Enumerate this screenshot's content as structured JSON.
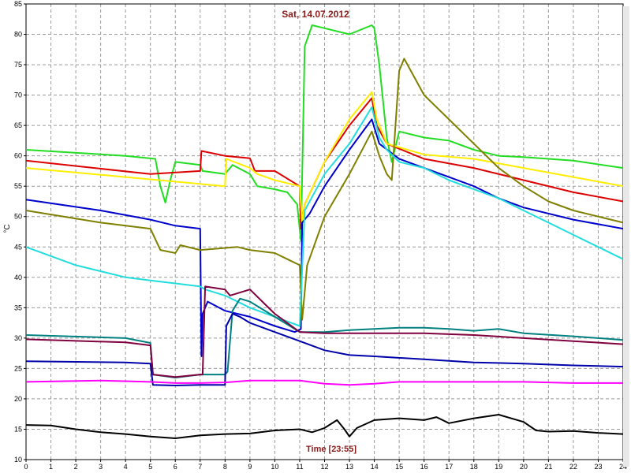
{
  "chart_data": {
    "type": "line",
    "title": "Sat, 14.07.2012",
    "xlabel": "Time [23:55]",
    "ylabel": "°C",
    "xlim": [
      0,
      24
    ],
    "ylim": [
      10,
      85
    ],
    "x_ticks": [
      "0",
      "1",
      "2",
      "3",
      "4",
      "5",
      "6",
      "7",
      "8",
      "9",
      "10",
      "11",
      "12",
      "13",
      "14",
      "15",
      "16",
      "17",
      "18",
      "19",
      "20",
      "21",
      "22",
      "23",
      "24"
    ],
    "y_ticks": [
      "10",
      "15",
      "20",
      "25",
      "30",
      "35",
      "40",
      "45",
      "50",
      "55",
      "60",
      "65",
      "70",
      "75",
      "80",
      "85"
    ],
    "grid": true,
    "series": [
      {
        "color": "#22dd22",
        "points": [
          [
            0,
            61
          ],
          [
            4,
            60
          ],
          [
            5.2,
            59.5
          ],
          [
            5.4,
            55
          ],
          [
            5.6,
            52.3
          ],
          [
            5.8,
            56
          ],
          [
            6,
            59
          ],
          [
            7,
            58.5
          ],
          [
            7.1,
            57.5
          ],
          [
            8,
            57
          ],
          [
            8.3,
            58.5
          ],
          [
            9,
            57
          ],
          [
            9.3,
            55
          ],
          [
            10,
            54.5
          ],
          [
            10.5,
            54
          ],
          [
            10.9,
            52
          ],
          [
            11.05,
            46
          ],
          [
            11.2,
            78
          ],
          [
            11.5,
            81.5
          ],
          [
            12,
            81
          ],
          [
            13,
            80
          ],
          [
            13.9,
            81.5
          ],
          [
            14,
            81
          ],
          [
            14.2,
            75
          ],
          [
            14.5,
            63
          ],
          [
            14.7,
            59
          ],
          [
            15,
            64
          ],
          [
            16,
            63
          ],
          [
            17,
            62.5
          ],
          [
            18,
            61
          ],
          [
            19,
            60
          ],
          [
            20,
            59.8
          ],
          [
            22,
            59.2
          ],
          [
            24,
            58
          ]
        ]
      },
      {
        "color": "#dd0000",
        "points": [
          [
            0,
            59.2
          ],
          [
            5,
            57
          ],
          [
            7,
            57.5
          ],
          [
            7.05,
            60.8
          ],
          [
            8,
            60
          ],
          [
            9,
            59.6
          ],
          [
            9.2,
            57.5
          ],
          [
            10,
            57.5
          ],
          [
            11,
            55
          ],
          [
            11.05,
            48
          ],
          [
            11.2,
            52
          ],
          [
            12,
            59
          ],
          [
            13,
            65
          ],
          [
            13.9,
            69.5
          ],
          [
            14.1,
            65
          ],
          [
            14.5,
            62
          ],
          [
            16,
            59.5
          ],
          [
            18,
            58
          ],
          [
            20,
            56
          ],
          [
            22,
            54
          ],
          [
            24,
            52.5
          ]
        ]
      },
      {
        "color": "#ffee00",
        "points": [
          [
            0,
            58
          ],
          [
            4,
            56.5
          ],
          [
            8,
            55
          ],
          [
            8.05,
            59.5
          ],
          [
            9,
            58
          ],
          [
            9.3,
            57
          ],
          [
            10,
            56
          ],
          [
            11,
            55
          ],
          [
            11.1,
            49
          ],
          [
            11.2,
            52
          ],
          [
            12,
            59
          ],
          [
            13,
            66
          ],
          [
            13.9,
            70.5
          ],
          [
            14.1,
            66
          ],
          [
            14.5,
            62
          ],
          [
            16,
            60.2
          ],
          [
            18,
            59.5
          ],
          [
            20,
            58
          ],
          [
            22,
            56.5
          ],
          [
            24,
            55
          ]
        ]
      },
      {
        "color": "#0000cc",
        "points": [
          [
            0,
            52.8
          ],
          [
            3,
            51
          ],
          [
            5,
            49.5
          ],
          [
            6,
            48.5
          ],
          [
            7,
            48
          ],
          [
            7.05,
            27
          ],
          [
            7.1,
            34
          ],
          [
            7.3,
            36
          ],
          [
            8,
            34.5
          ],
          [
            9,
            33.5
          ],
          [
            10,
            32
          ],
          [
            10.8,
            31
          ],
          [
            11.05,
            31.5
          ],
          [
            11.1,
            49
          ],
          [
            11.4,
            50.5
          ],
          [
            12,
            55
          ],
          [
            13,
            61
          ],
          [
            13.9,
            66
          ],
          [
            14.2,
            62
          ],
          [
            15,
            59.5
          ],
          [
            16,
            58
          ],
          [
            17,
            56.5
          ],
          [
            18,
            55
          ],
          [
            19,
            53
          ],
          [
            20,
            51.5
          ],
          [
            22,
            49.5
          ],
          [
            24,
            48
          ]
        ]
      },
      {
        "color": "#808000",
        "points": [
          [
            0,
            51
          ],
          [
            3,
            49
          ],
          [
            5,
            48
          ],
          [
            5.4,
            44.5
          ],
          [
            6,
            44
          ],
          [
            6.2,
            45.3
          ],
          [
            7,
            44.5
          ],
          [
            8.5,
            45
          ],
          [
            9,
            44.5
          ],
          [
            10,
            44
          ],
          [
            10.5,
            43
          ],
          [
            11,
            42
          ],
          [
            11.1,
            33
          ],
          [
            11.3,
            42
          ],
          [
            12,
            50
          ],
          [
            13,
            57
          ],
          [
            13.9,
            64
          ],
          [
            14.2,
            60
          ],
          [
            14.5,
            57
          ],
          [
            14.7,
            56
          ],
          [
            15,
            74
          ],
          [
            15.2,
            76
          ],
          [
            16,
            70
          ],
          [
            17,
            66
          ],
          [
            18,
            62
          ],
          [
            19,
            58
          ],
          [
            20,
            55
          ],
          [
            21,
            52.5
          ],
          [
            22,
            51
          ],
          [
            23,
            50
          ],
          [
            24,
            49
          ]
        ]
      },
      {
        "color": "#22dddd",
        "points": [
          [
            0,
            45
          ],
          [
            2,
            42
          ],
          [
            4,
            40
          ],
          [
            5,
            39.5
          ],
          [
            6,
            39
          ],
          [
            7,
            38.5
          ],
          [
            7.2,
            38
          ],
          [
            8,
            37
          ],
          [
            9,
            35
          ],
          [
            10,
            33.5
          ],
          [
            11,
            32
          ],
          [
            11.2,
            51
          ],
          [
            12,
            57
          ],
          [
            13,
            62
          ],
          [
            13.9,
            68
          ],
          [
            14.2,
            63
          ],
          [
            14.5,
            61
          ],
          [
            15,
            59
          ],
          [
            16,
            58
          ],
          [
            17,
            56
          ],
          [
            18,
            54.5
          ],
          [
            19,
            53
          ],
          [
            20,
            51
          ],
          [
            21,
            49
          ],
          [
            22,
            47
          ],
          [
            23,
            45
          ],
          [
            24,
            43
          ]
        ]
      },
      {
        "color": "#008080",
        "points": [
          [
            0,
            30.5
          ],
          [
            4,
            30
          ],
          [
            5,
            29.2
          ],
          [
            5.1,
            24
          ],
          [
            6,
            23.5
          ],
          [
            7,
            24
          ],
          [
            8,
            24
          ],
          [
            8.1,
            24.5
          ],
          [
            8.3,
            34.5
          ],
          [
            8.6,
            36.5
          ],
          [
            9,
            36
          ],
          [
            10,
            33.5
          ],
          [
            11,
            31
          ],
          [
            12,
            31
          ],
          [
            13,
            31.3
          ],
          [
            14,
            31.5
          ],
          [
            15,
            31.7
          ],
          [
            16,
            31.7
          ],
          [
            17,
            31.5
          ],
          [
            18,
            31.2
          ],
          [
            19,
            31.5
          ],
          [
            20,
            30.8
          ],
          [
            22,
            30.3
          ],
          [
            24,
            29.7
          ]
        ]
      },
      {
        "color": "#800040",
        "points": [
          [
            0,
            29.8
          ],
          [
            4,
            29.3
          ],
          [
            5,
            28.8
          ],
          [
            5.1,
            24
          ],
          [
            6,
            23.6
          ],
          [
            7,
            24
          ],
          [
            7.1,
            24
          ],
          [
            7.2,
            38.5
          ],
          [
            8,
            38
          ],
          [
            8.2,
            37
          ],
          [
            9,
            38
          ],
          [
            9.5,
            36
          ],
          [
            10,
            34
          ],
          [
            11,
            31
          ],
          [
            12,
            30.8
          ],
          [
            14,
            30.8
          ],
          [
            16,
            30.8
          ],
          [
            18,
            30.5
          ],
          [
            20,
            30
          ],
          [
            22,
            29.5
          ],
          [
            24,
            29
          ]
        ]
      },
      {
        "color": "#0000aa",
        "points": [
          [
            0,
            26.2
          ],
          [
            4,
            26
          ],
          [
            5,
            25.8
          ],
          [
            5.1,
            22.3
          ],
          [
            6,
            22.2
          ],
          [
            7,
            22.3
          ],
          [
            8,
            22.3
          ],
          [
            8.05,
            32
          ],
          [
            8.3,
            34
          ],
          [
            8.6,
            33.5
          ],
          [
            9,
            32.5
          ],
          [
            10,
            31
          ],
          [
            11,
            29.5
          ],
          [
            12,
            28
          ],
          [
            13,
            27.2
          ],
          [
            14,
            27
          ],
          [
            16,
            26.5
          ],
          [
            18,
            26
          ],
          [
            20,
            25.8
          ],
          [
            22,
            25.5
          ],
          [
            24,
            25.3
          ]
        ]
      },
      {
        "color": "#ff00ff",
        "points": [
          [
            0,
            22.8
          ],
          [
            3,
            23
          ],
          [
            5,
            22.8
          ],
          [
            6,
            22.6
          ],
          [
            7,
            22.6
          ],
          [
            8,
            22.7
          ],
          [
            9,
            23
          ],
          [
            10,
            23
          ],
          [
            11,
            23
          ],
          [
            12,
            22.5
          ],
          [
            13,
            22.3
          ],
          [
            14,
            22.5
          ],
          [
            15,
            22.8
          ],
          [
            16,
            22.8
          ],
          [
            18,
            22.8
          ],
          [
            20,
            22.8
          ],
          [
            22,
            22.6
          ],
          [
            24,
            22.6
          ]
        ]
      },
      {
        "color": "#000000",
        "points": [
          [
            0,
            15.7
          ],
          [
            1,
            15.6
          ],
          [
            2,
            15
          ],
          [
            3,
            14.5
          ],
          [
            4,
            14.2
          ],
          [
            5,
            13.8
          ],
          [
            6,
            13.5
          ],
          [
            7,
            14
          ],
          [
            8,
            14.2
          ],
          [
            9,
            14.3
          ],
          [
            10,
            14.8
          ],
          [
            11,
            15
          ],
          [
            11.5,
            14.5
          ],
          [
            12,
            15.2
          ],
          [
            12.5,
            16.5
          ],
          [
            12.8,
            15
          ],
          [
            13,
            13.8
          ],
          [
            13.3,
            15.2
          ],
          [
            14,
            16.5
          ],
          [
            15,
            16.8
          ],
          [
            16,
            16.5
          ],
          [
            16.5,
            17
          ],
          [
            17,
            16
          ],
          [
            18,
            16.8
          ],
          [
            19,
            17.4
          ],
          [
            20,
            16.2
          ],
          [
            20.5,
            14.8
          ],
          [
            21,
            14.6
          ],
          [
            22,
            14.7
          ],
          [
            23,
            14.4
          ],
          [
            24,
            14.2
          ]
        ]
      }
    ]
  }
}
